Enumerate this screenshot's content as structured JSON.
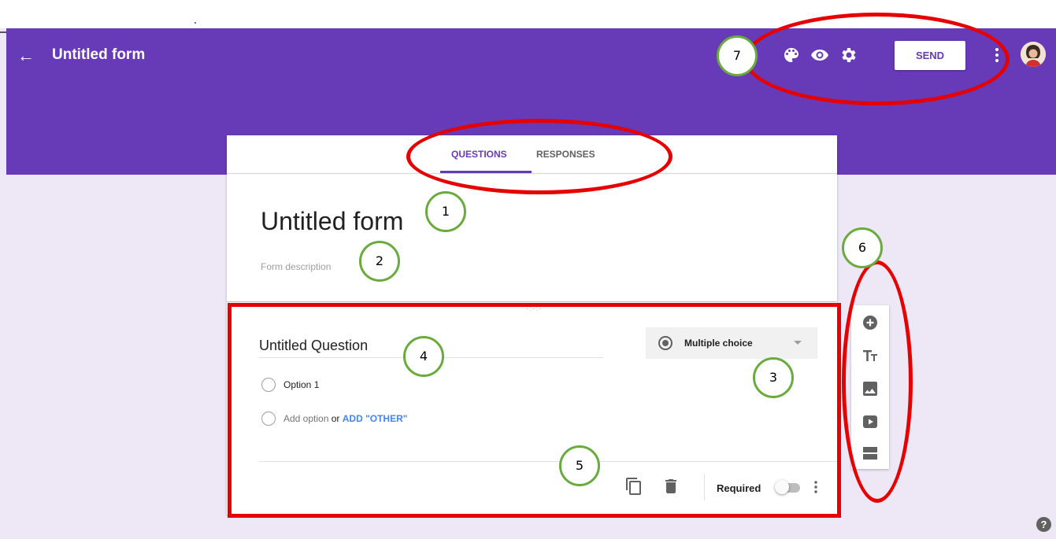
{
  "header": {
    "back_icon": "arrow-left-icon",
    "back_glyph": "←",
    "title": "Untitled form",
    "icons": [
      "palette-icon",
      "eye-icon",
      "gear-icon"
    ],
    "send_label": "SEND",
    "more_icon": "more-vertical-icon",
    "avatar_icon": "avatar"
  },
  "tabs": {
    "questions": "QUESTIONS",
    "responses": "RESPONSES",
    "active": "QUESTIONS"
  },
  "form": {
    "title": "Untitled form",
    "description_placeholder": "Form description"
  },
  "question": {
    "title": "Untitled Question",
    "type": "Multiple choice",
    "options": [
      "Option 1"
    ],
    "add_option": "Add option",
    "or": "or",
    "add_other": "ADD \"OTHER\"",
    "required_label": "Required",
    "required": false,
    "footer_icons": [
      "copy-icon",
      "delete-icon",
      "more-vertical-icon"
    ]
  },
  "sidebar": {
    "icons": [
      "add-question-icon",
      "title-text-icon",
      "image-icon",
      "video-icon",
      "section-icon"
    ]
  },
  "callouts": [
    "1",
    "2",
    "3",
    "4",
    "5",
    "6",
    "7"
  ],
  "help": "?",
  "colors": {
    "primary": "#673ab7",
    "background": "#ede7f6",
    "annotation_red": "#e60000",
    "annotation_green": "#6aab3d",
    "link_blue": "#4285f4"
  }
}
